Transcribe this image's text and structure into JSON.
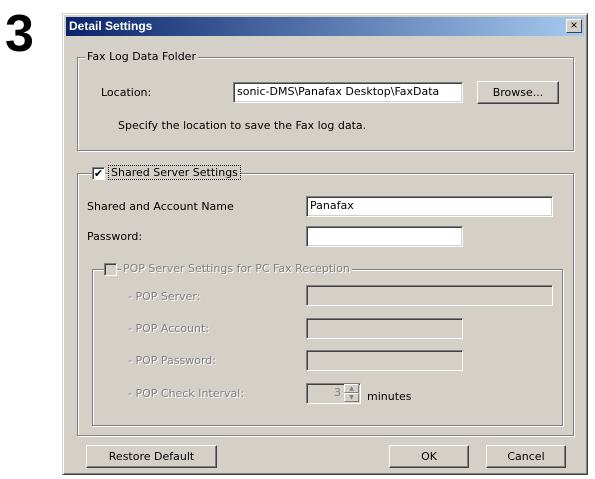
{
  "step_number": "3",
  "window": {
    "title": "Detail Settings",
    "close_glyph": "×"
  },
  "fax_log": {
    "legend": "Fax Log Data Folder",
    "location_label": "Location:",
    "location_value": "sonic-DMS\\Panafax Desktop\\FaxData",
    "browse_label": "Browse...",
    "hint": "Specify the location to save the Fax log data."
  },
  "shared": {
    "checked": true,
    "check_glyph": "✔",
    "legend": "Shared Server Settings",
    "account_label": "Shared and Account Name",
    "account_value": "Panafax",
    "password_label": "Password:",
    "password_value": ""
  },
  "pop": {
    "checked": false,
    "enabled": false,
    "legend": "POP Server Settings for PC Fax Reception",
    "server_label": "- POP Server:",
    "account_label": "- POP Account:",
    "password_label": "- POP Password:",
    "interval_label": "- POP Check Interval:",
    "interval_value": "3",
    "interval_unit": "minutes"
  },
  "buttons": {
    "restore_default": "Restore Default",
    "ok": "OK",
    "cancel": "Cancel"
  }
}
